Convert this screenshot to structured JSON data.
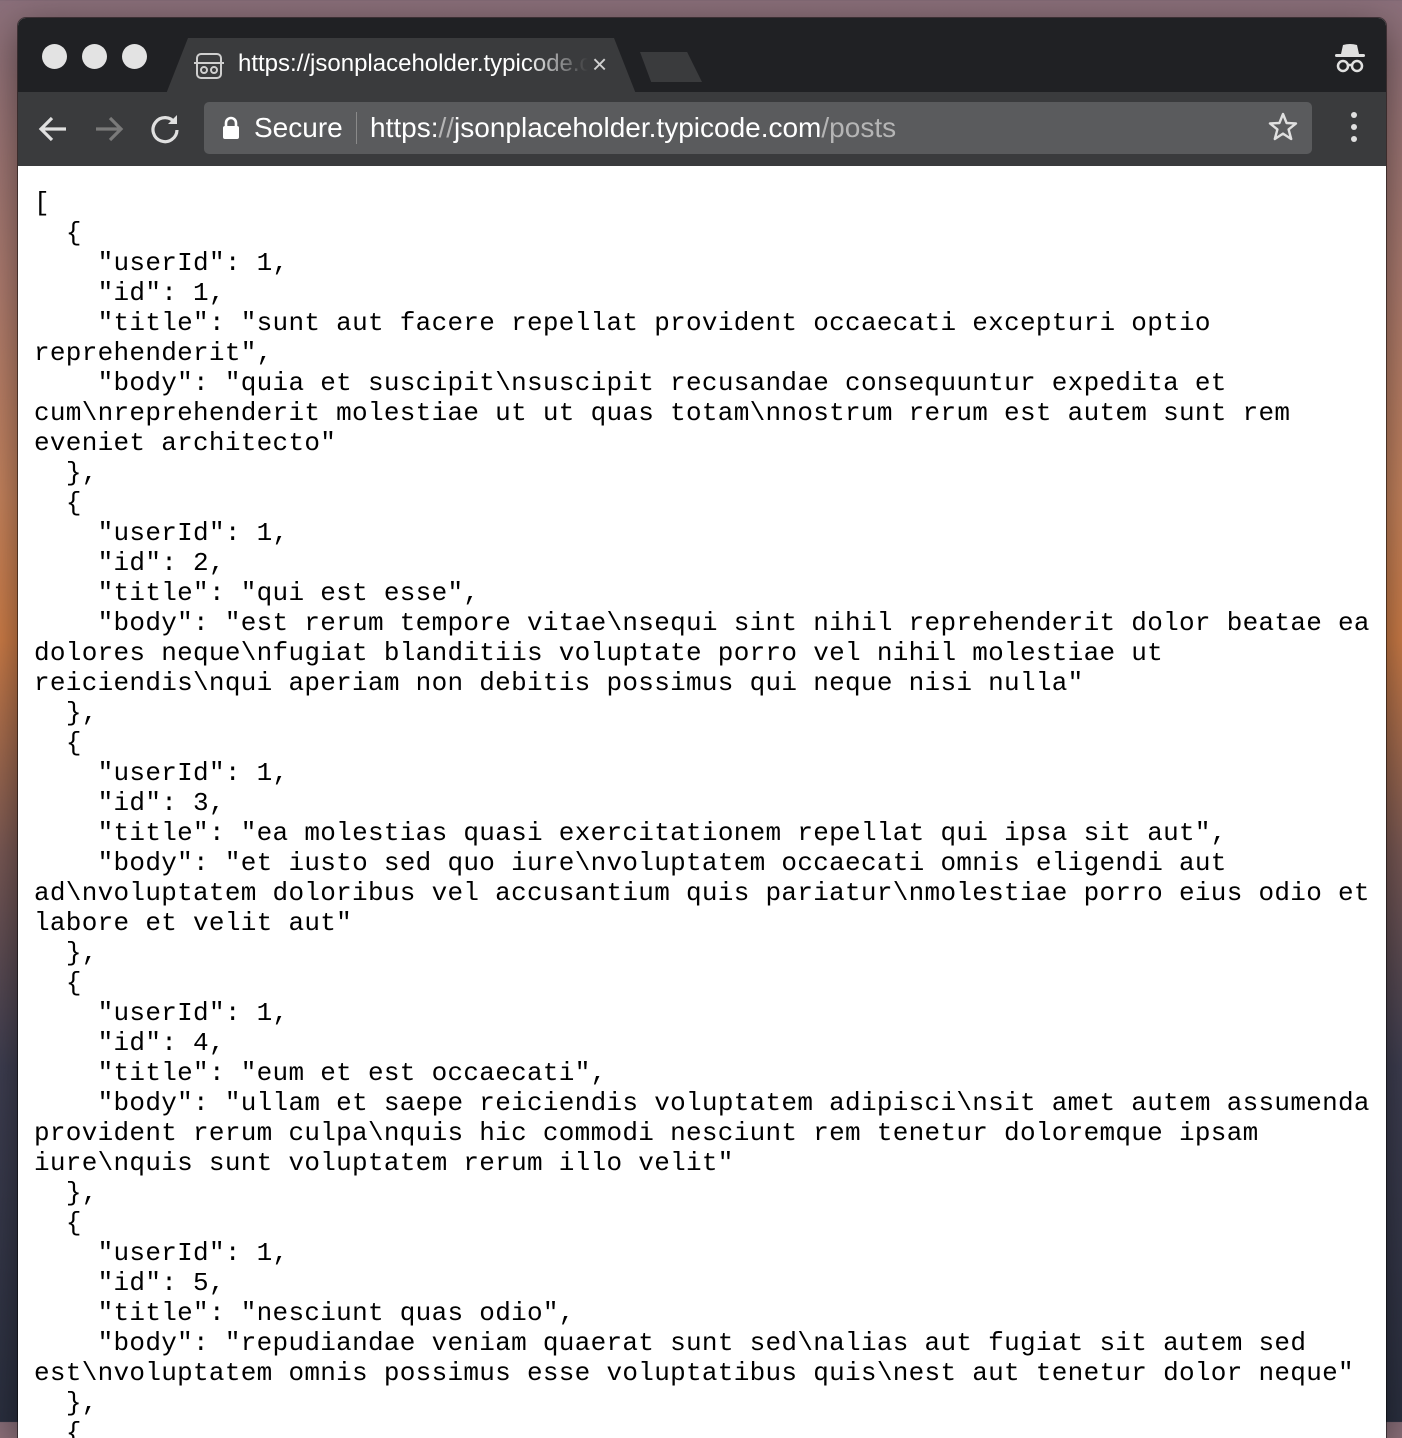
{
  "browser": {
    "tab_title": "https://jsonplaceholder.typicode.com/posts",
    "tab_close": "×",
    "security_label": "Secure",
    "url_scheme": "https:",
    "url_sep": "//",
    "url_host": "jsonplaceholder.typicode.com",
    "url_path": "/posts"
  },
  "page": {
    "json_text": "[\n  {\n    \"userId\": 1,\n    \"id\": 1,\n    \"title\": \"sunt aut facere repellat provident occaecati excepturi optio reprehenderit\",\n    \"body\": \"quia et suscipit\\nsuscipit recusandae consequuntur expedita et cum\\nreprehenderit molestiae ut ut quas totam\\nnostrum rerum est autem sunt rem eveniet architecto\"\n  },\n  {\n    \"userId\": 1,\n    \"id\": 2,\n    \"title\": \"qui est esse\",\n    \"body\": \"est rerum tempore vitae\\nsequi sint nihil reprehenderit dolor beatae ea dolores neque\\nfugiat blanditiis voluptate porro vel nihil molestiae ut reiciendis\\nqui aperiam non debitis possimus qui neque nisi nulla\"\n  },\n  {\n    \"userId\": 1,\n    \"id\": 3,\n    \"title\": \"ea molestias quasi exercitationem repellat qui ipsa sit aut\",\n    \"body\": \"et iusto sed quo iure\\nvoluptatem occaecati omnis eligendi aut ad\\nvoluptatem doloribus vel accusantium quis pariatur\\nmolestiae porro eius odio et labore et velit aut\"\n  },\n  {\n    \"userId\": 1,\n    \"id\": 4,\n    \"title\": \"eum et est occaecati\",\n    \"body\": \"ullam et saepe reiciendis voluptatem adipisci\\nsit amet autem assumenda provident rerum culpa\\nquis hic commodi nesciunt rem tenetur doloremque ipsam iure\\nquis sunt voluptatem rerum illo velit\"\n  },\n  {\n    \"userId\": 1,\n    \"id\": 5,\n    \"title\": \"nesciunt quas odio\",\n    \"body\": \"repudiandae veniam quaerat sunt sed\\nalias aut fugiat sit autem sed est\\nvoluptatem omnis possimus esse voluptatibus quis\\nest aut tenetur dolor neque\"\n  },\n  {"
  },
  "icons": {
    "tab_favicon": "incognito-tab-icon",
    "incognito": "incognito-icon",
    "back": "back-arrow-icon",
    "forward": "forward-arrow-icon",
    "reload": "reload-icon",
    "lock": "lock-icon",
    "bookmark": "star-icon",
    "menu": "kebab-menu-icon"
  },
  "colors": {
    "titlebar": "#202124",
    "toolbar": "#3a3b3d",
    "omnibox": "#5a5b5d",
    "url_dim": "#b5b5b5"
  }
}
